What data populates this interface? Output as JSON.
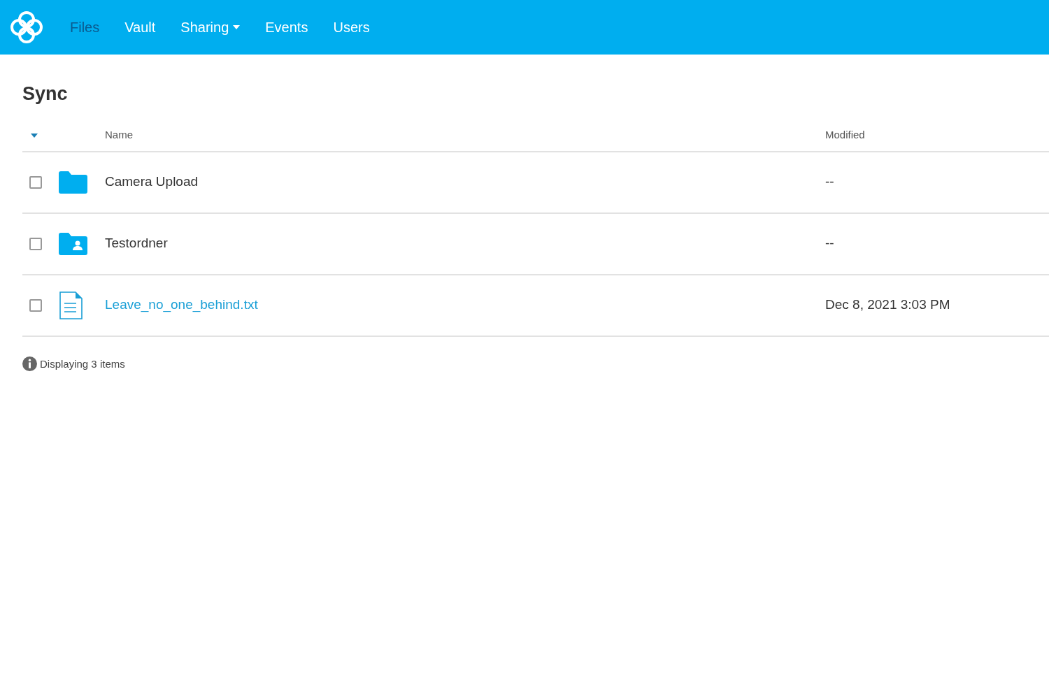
{
  "nav": {
    "items": [
      {
        "label": "Files",
        "selected": true,
        "dropdown": false
      },
      {
        "label": "Vault",
        "selected": false,
        "dropdown": false
      },
      {
        "label": "Sharing",
        "selected": false,
        "dropdown": true
      },
      {
        "label": "Events",
        "selected": false,
        "dropdown": false
      },
      {
        "label": "Users",
        "selected": false,
        "dropdown": false
      }
    ]
  },
  "page_title": "Sync",
  "table": {
    "columns": [
      "Name",
      "Modified"
    ],
    "rows": [
      {
        "kind": "folder",
        "name": "Camera Upload",
        "modified": "--",
        "checked": false
      },
      {
        "kind": "shared-folder",
        "name": "Testordner",
        "modified": "--",
        "checked": false
      },
      {
        "kind": "file",
        "name": "Leave_no_one_behind.txt",
        "modified": "Dec 8, 2021 3:03 PM",
        "checked": false
      }
    ]
  },
  "status": "Displaying 3 items"
}
